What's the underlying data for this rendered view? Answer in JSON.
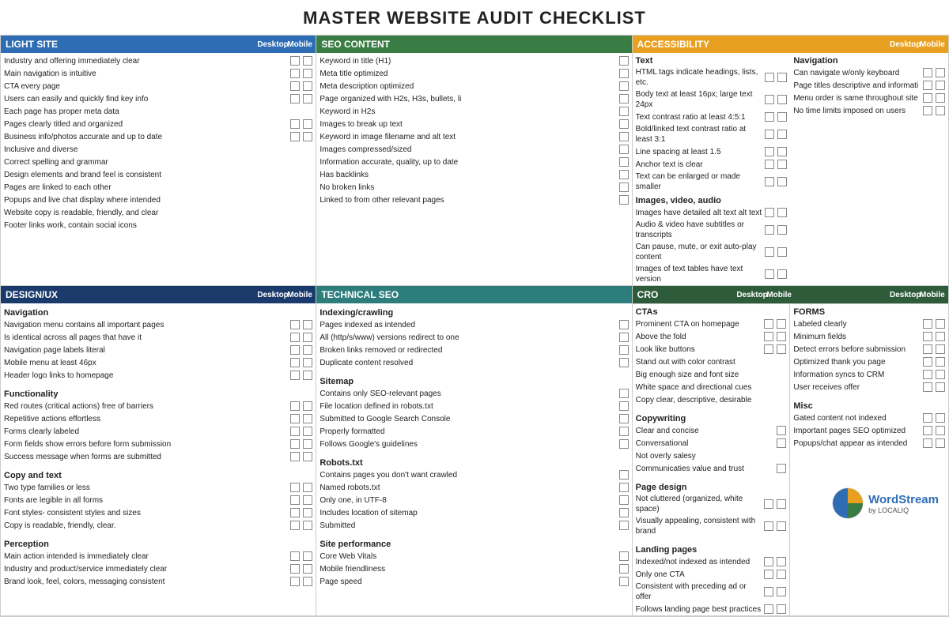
{
  "title": "MASTER WEBSITE AUDIT CHECKLIST",
  "sections": {
    "light_site": {
      "label": "LIGHT SITE",
      "color": "blue",
      "col_headers": [
        "Desktop",
        "Mobile"
      ],
      "items": [
        {
          "text": "Industry and offering immediately clear",
          "boxes": 2
        },
        {
          "text": "Main navigation is intuitive",
          "boxes": 2
        },
        {
          "text": "CTA every page",
          "boxes": 2
        },
        {
          "text": "Users can easily and quickly find key info",
          "boxes": 2
        },
        {
          "text": "Each page has proper meta data",
          "boxes": 0
        },
        {
          "text": "Pages clearly titled and organized",
          "boxes": 2
        },
        {
          "text": "Business info/photos accurate and up to date",
          "boxes": 2
        },
        {
          "text": "Inclusive and diverse",
          "boxes": 0
        },
        {
          "text": "Correct spelling and grammar",
          "boxes": 0
        },
        {
          "text": "Design elements and brand feel is consistent",
          "boxes": 0
        },
        {
          "text": "Pages are linked to each other",
          "boxes": 0
        },
        {
          "text": "Popups and live chat display where intended",
          "boxes": 0
        },
        {
          "text": "Website copy is readable, friendly, and clear",
          "boxes": 0
        },
        {
          "text": "Footer links work, contain social icons",
          "boxes": 0
        }
      ]
    },
    "seo_content": {
      "label": "SEO CONTENT",
      "color": "green",
      "items": [
        {
          "text": "Keyword in title (H1)",
          "boxes": 1
        },
        {
          "text": "Meta title optimized",
          "boxes": 1
        },
        {
          "text": "Meta description optimized",
          "boxes": 1
        },
        {
          "text": "Page organized with H2s, H3s, bullets, li",
          "boxes": 1
        },
        {
          "text": "Keyword in H2s",
          "boxes": 1
        },
        {
          "text": "Images to break up text",
          "boxes": 1
        },
        {
          "text": "Keyword in image filename and alt text",
          "boxes": 1
        },
        {
          "text": "Images compressed/sized",
          "boxes": 1
        },
        {
          "text": "Information accurate, quality, up to date",
          "boxes": 1
        },
        {
          "text": "Has backlinks",
          "boxes": 1
        },
        {
          "text": "No broken links",
          "boxes": 1
        },
        {
          "text": "Linked to from other relevant pages",
          "boxes": 1
        }
      ]
    },
    "accessibility": {
      "label": "ACCESSIBILITY",
      "color": "orange",
      "col_headers": [
        "Desktop",
        "Mobile"
      ],
      "subsections": [
        {
          "title": "Text",
          "items": [
            {
              "text": "HTML tags indicate headings, lists, etc.",
              "boxes": 2
            },
            {
              "text": "Body text at least 16px; large text 24px",
              "boxes": 2
            },
            {
              "text": "Text contrast ratio at least 4:5:1",
              "boxes": 2
            },
            {
              "text": "Bold/linked text contrast ratio at least 3:1",
              "boxes": 2
            },
            {
              "text": "Line spacing at least 1.5",
              "boxes": 2
            },
            {
              "text": "Anchor text is clear",
              "boxes": 2
            },
            {
              "text": "Text can be enlarged or made smaller",
              "boxes": 2
            }
          ]
        },
        {
          "title": "Images, video, audio",
          "items": [
            {
              "text": "Images have detailed alt text alt text",
              "boxes": 2
            },
            {
              "text": "Audio & video have subtitles or transcripts",
              "boxes": 2
            },
            {
              "text": "Can pause, mute, or exit auto-play content",
              "boxes": 2
            },
            {
              "text": "Images of text tables have text version",
              "boxes": 2
            }
          ]
        }
      ],
      "nav_subsection": {
        "title": "Navigation",
        "items": [
          {
            "text": "Can navigate w/only keyboard",
            "boxes": 2
          },
          {
            "text": "Page titles descriptive and informati",
            "boxes": 2
          },
          {
            "text": "Menu order is same throughout site",
            "boxes": 2
          },
          {
            "text": "No time limits imposed on users",
            "boxes": 2
          }
        ]
      }
    },
    "design_ux": {
      "label": "DESIGN/UX",
      "color": "dark-blue",
      "col_headers": [
        "Desktop",
        "Mobile"
      ],
      "subsections": [
        {
          "title": "Navigation",
          "items": [
            {
              "text": "Navigation menu contains all important pages",
              "boxes": 2
            },
            {
              "text": "Is identical across all pages that have it",
              "boxes": 2
            },
            {
              "text": "Navigation page labels literal",
              "boxes": 2
            },
            {
              "text": "Mobile menu at least 46px",
              "boxes": 2
            },
            {
              "text": "Header logo links to homepage",
              "boxes": 2
            }
          ]
        },
        {
          "title": "Functionality",
          "items": [
            {
              "text": "Red routes (critical actions) free of barriers",
              "boxes": 2
            },
            {
              "text": "Repetitive actions effortless",
              "boxes": 2
            },
            {
              "text": "Forms clearly labeled",
              "boxes": 2
            },
            {
              "text": "Form fields show errors before form submission",
              "boxes": 2
            },
            {
              "text": "Success message when forms are submitted",
              "boxes": 2
            }
          ]
        },
        {
          "title": "Copy and text",
          "items": [
            {
              "text": "Two type families or less",
              "boxes": 2
            },
            {
              "text": "Fonts are legible in all forms",
              "boxes": 2
            },
            {
              "text": "Font styles- consistent styles and sizes",
              "boxes": 2
            },
            {
              "text": "Copy is readable, friendly, clear.",
              "boxes": 2
            }
          ]
        },
        {
          "title": "Perception",
          "items": [
            {
              "text": "Main action intended is immediately clear",
              "boxes": 2
            },
            {
              "text": "Industry and product/service immediately clear",
              "boxes": 2
            },
            {
              "text": "Brand look, feel, colors, messaging consistent",
              "boxes": 2
            }
          ]
        }
      ]
    },
    "technical_seo": {
      "label": "TECHNICAL SEO",
      "color": "teal",
      "subsections": [
        {
          "title": "Indexing/crawling",
          "items": [
            {
              "text": "Pages indexed as intended",
              "boxes": 1
            },
            {
              "text": "All (http/s/www) versions redirect to one",
              "boxes": 1
            },
            {
              "text": "Broken links removed or redirected",
              "boxes": 1
            },
            {
              "text": "Duplicate content resolved",
              "boxes": 1
            }
          ]
        },
        {
          "title": "Sitemap",
          "items": [
            {
              "text": "Contains only SEO-relevant pages",
              "boxes": 1
            },
            {
              "text": "File location defined in robots.txt",
              "boxes": 1
            },
            {
              "text": "Submitted to Google Search Console",
              "boxes": 1
            },
            {
              "text": "Properly formatted",
              "boxes": 1
            },
            {
              "text": "Follows Google's guidelines",
              "boxes": 1
            }
          ]
        },
        {
          "title": "Robots.txt",
          "items": [
            {
              "text": "Contains pages you don't want crawled",
              "boxes": 1
            },
            {
              "text": "Named robots.txt",
              "boxes": 1
            },
            {
              "text": "Only one, in UTF-8",
              "boxes": 1
            },
            {
              "text": "Includes location of sitemap",
              "boxes": 1
            },
            {
              "text": "Submitted",
              "boxes": 1
            }
          ]
        },
        {
          "title": "Site performance",
          "items": [
            {
              "text": "Core Web Vitals",
              "boxes": 1
            },
            {
              "text": "Mobile friendliness",
              "boxes": 1
            },
            {
              "text": "Page speed",
              "boxes": 1
            }
          ]
        }
      ]
    },
    "cro": {
      "label": "CRO",
      "color": "dark-green",
      "col_headers_left": [
        "Desktop",
        "Mobile"
      ],
      "subsections_left": [
        {
          "title": "CTAs",
          "items": [
            {
              "text": "Prominent CTA on homepage",
              "boxes": 2
            },
            {
              "text": "Above the fold",
              "boxes": 2
            },
            {
              "text": "Look like buttons",
              "boxes": 2
            },
            {
              "text": "Stand out with color contrast",
              "boxes": 0
            },
            {
              "text": "Big enough size and font size",
              "boxes": 0
            },
            {
              "text": "White space and directional cues",
              "boxes": 0
            },
            {
              "text": "Copy clear, descriptive, desirable",
              "boxes": 0
            }
          ]
        },
        {
          "title": "Copywriting",
          "items": [
            {
              "text": "Clear and concise",
              "boxes": 1
            },
            {
              "text": "Conversational",
              "boxes": 1
            },
            {
              "text": "Not overly salesy",
              "boxes": 0
            },
            {
              "text": "Communicaties value and trust",
              "boxes": 1
            }
          ]
        },
        {
          "title": "Page design",
          "items": [
            {
              "text": "Not cluttered (organized, white space)",
              "boxes": 2
            },
            {
              "text": "Visually appealing, consistent with brand",
              "boxes": 2
            }
          ]
        },
        {
          "title": "Landing pages",
          "items": [
            {
              "text": "Indexed/not indexed as intended",
              "boxes": 2
            },
            {
              "text": "Only one CTA",
              "boxes": 2
            },
            {
              "text": "Consistent with preceding ad or offer",
              "boxes": 2
            },
            {
              "text": "Follows landing page best practices",
              "boxes": 2
            }
          ]
        }
      ],
      "subsections_right": [
        {
          "title": "FORMS",
          "items": [
            {
              "text": "Labeled clearly",
              "boxes": 2
            },
            {
              "text": "Minimum fields",
              "boxes": 2
            },
            {
              "text": "Detect errors before submission",
              "boxes": 2
            },
            {
              "text": "Optimized thank you page",
              "boxes": 2
            },
            {
              "text": "Information syncs to CRM",
              "boxes": 2
            },
            {
              "text": "User receives offer",
              "boxes": 2
            }
          ]
        },
        {
          "title": "Misc",
          "items": [
            {
              "text": "Gated content not indexed",
              "boxes": 2
            },
            {
              "text": "Important pages SEO optimized",
              "boxes": 2
            },
            {
              "text": "Popups/chat appear as intended",
              "boxes": 2
            }
          ]
        }
      ]
    }
  },
  "logo": {
    "word": "WordStream",
    "sub": "by LOCALIQ"
  }
}
